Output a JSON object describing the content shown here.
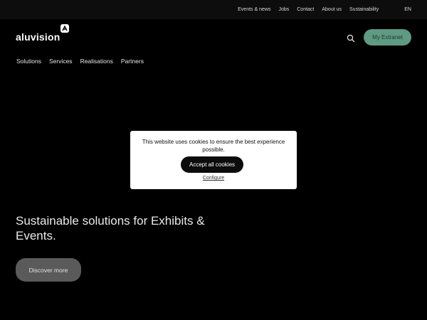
{
  "topbar": {
    "links": [
      "Events & news",
      "Jobs",
      "Contact",
      "About us",
      "Sustainability"
    ],
    "language": "EN"
  },
  "header": {
    "logo_text": "aluvision",
    "logo_mark": "A",
    "extranet_label": "My Extranet"
  },
  "nav": {
    "items": [
      "Solutions",
      "Services",
      "Realisations",
      "Partners"
    ]
  },
  "cookie": {
    "message": "This website uses cookies to ensure the best experience possible.",
    "accept_label": "Accept all cookies",
    "configure_label": "Configure"
  },
  "hero": {
    "title": "Sustainable solutions for Exhibits & Events.",
    "cta_label": "Discover more"
  },
  "colors": {
    "background": "#000000",
    "accent": "#5f9a83",
    "cta": "#5a5a5a"
  }
}
